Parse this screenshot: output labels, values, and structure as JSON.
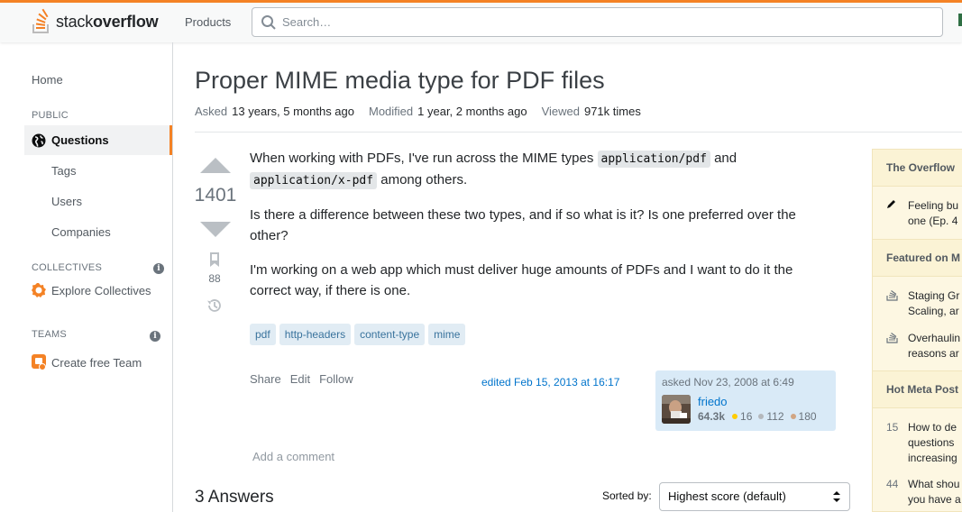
{
  "header": {
    "logo_light": "stack",
    "logo_bold": "overflow",
    "products_label": "Products",
    "search_placeholder": "Search…"
  },
  "sidebar": {
    "home": "Home",
    "public_section": "PUBLIC",
    "questions": "Questions",
    "tags": "Tags",
    "users": "Users",
    "companies": "Companies",
    "collectives_section": "COLLECTIVES",
    "explore_collectives": "Explore Collectives",
    "teams_section": "TEAMS",
    "create_team": "Create free Team"
  },
  "question": {
    "title": "Proper MIME media type for PDF files",
    "meta": [
      {
        "label": "Asked",
        "value": "13 years, 5 months ago"
      },
      {
        "label": "Modified",
        "value": "1 year, 2 months ago"
      },
      {
        "label": "Viewed",
        "value": "971k times"
      }
    ],
    "votes": "1401",
    "bookmarks": "88",
    "body": {
      "p1_a": "When working with PDFs, I've run across the MIME types ",
      "code1": "application/pdf",
      "p1_b": " and ",
      "code2": "application/x-pdf",
      "p1_c": " among others.",
      "p2": "Is there a difference between these two types, and if so what is it? Is one preferred over the other?",
      "p3": "I'm working on a web app which must deliver huge amounts of PDFs and I want to do it the correct way, if there is one."
    },
    "tags": [
      "pdf",
      "http-headers",
      "content-type",
      "mime"
    ],
    "menu": {
      "share": "Share",
      "edit": "Edit",
      "follow": "Follow"
    },
    "edited": "edited Feb 15, 2013 at 16:17",
    "owner": {
      "asked": "asked Nov 23, 2008 at 6:49",
      "name": "friedo",
      "reputation": "64.3k",
      "gold": "16",
      "silver": "112",
      "bronze": "180"
    },
    "add_comment": "Add a comment"
  },
  "answers": {
    "count_label": "3 Answers",
    "sorted_by": "Sorted by:",
    "sort_value": "Highest score (default)"
  },
  "right_sidebar": {
    "overflow_blog": "The Overflow",
    "blog_item": "Feeling bu one (Ep. 4",
    "featured_meta": "Featured on M",
    "featured_1": "Staging Gr Scaling, ar",
    "featured_2": "Overhaulin reasons ar",
    "hot_meta": "Hot Meta Post",
    "hot_1_num": "15",
    "hot_1": "How to de questions increasing",
    "hot_2_num": "44",
    "hot_2": "What shou you have a"
  },
  "colors": {
    "accent": "#f48225",
    "link": "#0074cc",
    "tag_bg": "#e1ecf4",
    "tag_text": "#39739d",
    "owner_bg": "#d9eaf7",
    "gold": "#ffcc01",
    "silver": "#b4b8bc",
    "bronze": "#d1a684"
  }
}
